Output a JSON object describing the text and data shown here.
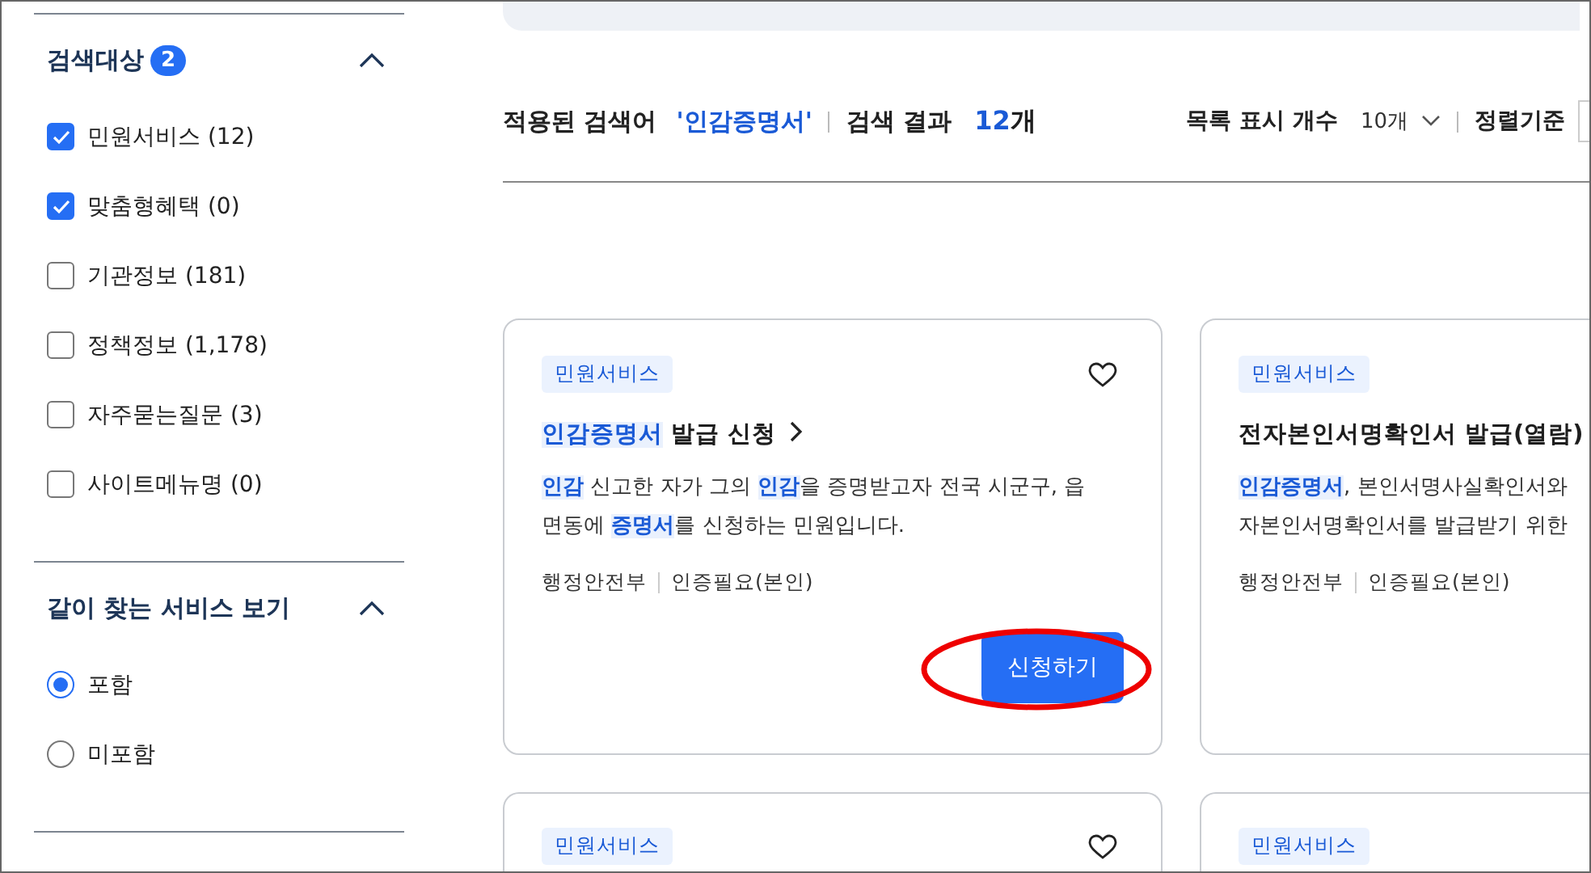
{
  "filters": {
    "sections": [
      {
        "title": "검색대상",
        "badge": "2",
        "expanded": true,
        "kind": "checkbox",
        "options": [
          {
            "label": "민원서비스 (12)",
            "checked": true
          },
          {
            "label": "맞춤형혜택 (0)",
            "checked": true
          },
          {
            "label": "기관정보 (181)",
            "checked": false
          },
          {
            "label": "정책정보 (1,178)",
            "checked": false
          },
          {
            "label": "자주묻는질문 (3)",
            "checked": false
          },
          {
            "label": "사이트메뉴명 (0)",
            "checked": false
          }
        ]
      },
      {
        "title": "같이 찾는 서비스 보기",
        "expanded": true,
        "kind": "radio",
        "options": [
          {
            "label": "포함",
            "selected": true
          },
          {
            "label": "미포함",
            "selected": false
          }
        ]
      }
    ]
  },
  "summary": {
    "query_label": "적용된 검색어",
    "query": "'인감증명서'",
    "result_label": "검색 결과",
    "count": "12",
    "count_unit": "개",
    "page_size_label": "목록 표시 개수",
    "page_size": "10개",
    "sort_label": "정렬기준"
  },
  "cards": [
    {
      "category": "민원서비스",
      "favorite": false,
      "title": [
        {
          "text": "인감증명서",
          "highlight": true
        },
        {
          "text": " 발급 신청",
          "highlight": false
        }
      ],
      "link_arrow": true,
      "description": [
        [
          {
            "text": "인감",
            "highlight": true
          },
          {
            "text": " 신고한 자가 그의 ",
            "highlight": false
          },
          {
            "text": "인감",
            "highlight": true
          },
          {
            "text": "을 증명받고자 전국 시군구, 읍",
            "highlight": false
          }
        ],
        [
          {
            "text": "면동에 ",
            "highlight": false
          },
          {
            "text": "증명서",
            "highlight": true
          },
          {
            "text": "를 신청하는 민원입니다.",
            "highlight": false
          }
        ]
      ],
      "meta": [
        "행정안전부",
        "인증필요(본인)"
      ],
      "button": "신청하기",
      "circled": true
    },
    {
      "category": "민원서비스",
      "title": [
        {
          "text": "전자본인서명확인서 발급(열람)",
          "highlight": false
        }
      ],
      "link_arrow": false,
      "description": [
        [
          {
            "text": "인감증명서",
            "highlight": true
          },
          {
            "text": ", 본인서명사실확인서와",
            "highlight": false
          }
        ],
        [
          {
            "text": "자본인서명확인서를 발급받기 위한",
            "highlight": false
          }
        ]
      ],
      "meta": [
        "행정안전부",
        "인증필요(본인)"
      ],
      "circled": false
    },
    {
      "category": "민원서비스",
      "favorite": false
    },
    {
      "category": "민원서비스"
    }
  ]
}
